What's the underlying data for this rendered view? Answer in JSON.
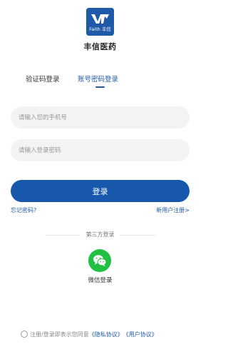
{
  "brand": {
    "logo_text": "Faith 丰信",
    "app_name": "丰信医药"
  },
  "tabs": [
    {
      "label": "验证码登录",
      "active": false
    },
    {
      "label": "账号密码登录",
      "active": true
    }
  ],
  "form": {
    "phone_placeholder": "请输入您的手机号",
    "password_placeholder": "请输入登录密码",
    "login_label": "登录",
    "forgot_label": "忘记密码?",
    "register_label": "新用户注册>"
  },
  "third_party": {
    "divider_label": "第三方登录",
    "wechat_label": "微信登录"
  },
  "agreement": {
    "prefix": "注册/登录即表示您同意",
    "privacy_label": "《隐私协议》",
    "user_label": "《用户协议》"
  },
  "colors": {
    "primary": "#1758ad",
    "wechat": "#20c043",
    "input_bg": "#f3f3f3"
  }
}
